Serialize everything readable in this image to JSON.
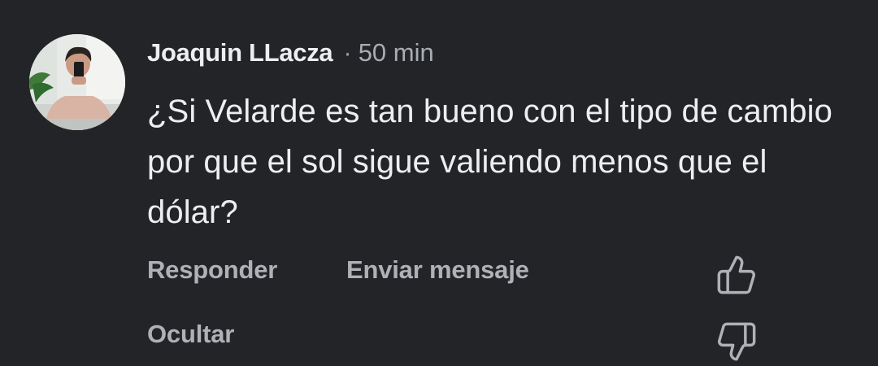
{
  "comment": {
    "author": "Joaquin LLacza",
    "separator": "·",
    "time": "50 min",
    "text": "¿Si Velarde es tan bueno con el tipo de cambio por que el sol sigue valiendo menos que el dólar?"
  },
  "actions": {
    "reply_label": "Responder",
    "message_label": "Enviar mensaje",
    "hide_label": "Ocultar"
  },
  "icons": {
    "like": "thumbs-up-icon",
    "dislike": "thumbs-down-icon"
  },
  "colors": {
    "background": "#232427",
    "primary_text": "#eceef0",
    "secondary_text": "#aeb1b6"
  }
}
